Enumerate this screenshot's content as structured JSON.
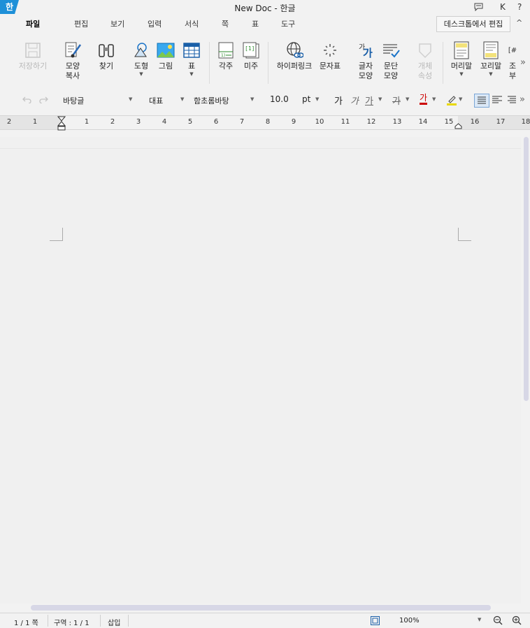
{
  "window": {
    "app_badge": "한",
    "title": "New Doc - 한글",
    "icons": [
      "comment-icon",
      "account-icon",
      "help-icon"
    ],
    "account_label": "K",
    "help_label": "?"
  },
  "menu": {
    "tabs": [
      "파일",
      "편집",
      "보기",
      "입력",
      "서식",
      "쪽",
      "표",
      "도구"
    ],
    "active": "파일",
    "desktop_edit_label": "데스크톱에서 편집",
    "collapse_label": "^"
  },
  "ribbon": {
    "save": "저장하기",
    "format_copy": [
      "모양",
      "복사"
    ],
    "find": "찾기",
    "shape": "도형",
    "picture": "그림",
    "table": "표",
    "footnote": "각주",
    "endnote": "미주",
    "hyperlink": "하이퍼링크",
    "char_map": "문자표",
    "char_shape": [
      "글자",
      "모양"
    ],
    "para_shape": [
      "문단",
      "모양"
    ],
    "object_props": [
      "개체",
      "속성"
    ],
    "header": "머리말",
    "footer": "꼬리말",
    "more": [
      "조",
      "부"
    ],
    "more_arrow": "»",
    "char_map_glyph_top": "가",
    "char_map_glyph": "가",
    "endnote_glyph": "[1]",
    "more_glyph": "[#"
  },
  "format_bar": {
    "style": "바탕글",
    "lang": "대표",
    "font": "함초롬바탕",
    "size": "10.0",
    "unit": "pt",
    "bold_glyph": "가",
    "italic_glyph": "가",
    "underline_glyph": "가",
    "strike_glyph": "가",
    "color_glyph": "가",
    "more_arrow": "»",
    "accent_red": "#cc0000",
    "highlight_yellow": "#e8d800"
  },
  "ruler": {
    "labels": [
      "2",
      "1",
      "1",
      "2",
      "3",
      "4",
      "5",
      "6",
      "7",
      "8",
      "9",
      "10",
      "11",
      "12",
      "13",
      "14",
      "15",
      "16",
      "17",
      "18"
    ]
  },
  "status": {
    "page": "1 / 1 쪽",
    "section": "구역 : 1 / 1",
    "mode": "삽입",
    "zoom": "100%"
  }
}
